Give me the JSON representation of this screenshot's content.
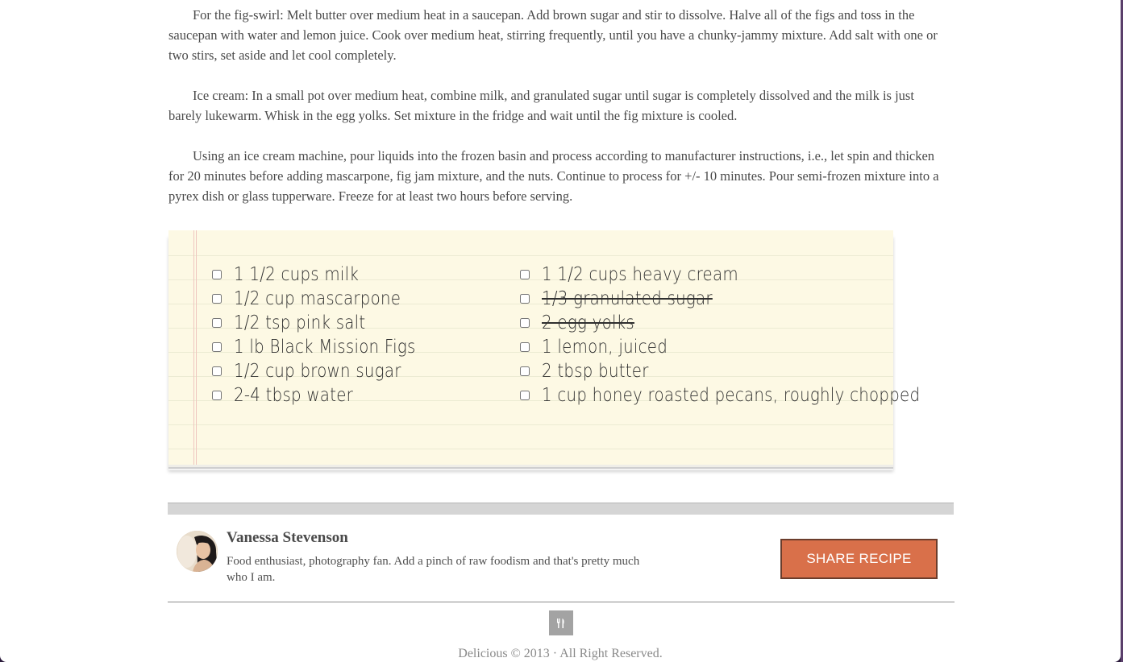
{
  "directions": [
    "For the fig-swirl: Melt butter over medium heat in a saucepan. Add brown sugar and stir to dissolve. Halve all of the figs and toss in the saucepan with water and lemon juice. Cook over medium heat, stirring frequently, until you have a chunky-jammy mixture. Add salt with one or two stirs, set aside and let cool completely.",
    "Ice cream: In a small pot over medium heat, combine milk, and granulated sugar until sugar is completely dissolved and the milk is just barely lukewarm. Whisk in the egg yolks. Set mixture in the fridge and wait until the fig mixture is cooled.",
    "Using an ice cream machine, pour liquids into the frozen basin and process according to manufacturer instructions, i.e., let spin and thicken for 20 minutes before adding mascarpone, fig jam mixture, and the nuts. Continue to process for +/- 10 minutes. Pour semi-frozen mixture into a pyrex dish or glass tupperware. Freeze for at least two hours before serving."
  ],
  "ingredients": {
    "left": [
      {
        "text": "1 1/2 cups milk",
        "checked": false,
        "struck": false
      },
      {
        "text": "1/2 cup mascarpone",
        "checked": false,
        "struck": false
      },
      {
        "text": "1/2 tsp pink salt",
        "checked": false,
        "struck": false
      },
      {
        "text": "1 lb Black Mission Figs",
        "checked": false,
        "struck": false
      },
      {
        "text": "1/2 cup brown sugar",
        "checked": false,
        "struck": false
      },
      {
        "text": "2-4 tbsp water",
        "checked": false,
        "struck": false
      }
    ],
    "right": [
      {
        "text": "1 1/2 cups heavy cream",
        "checked": false,
        "struck": false
      },
      {
        "text": "1/3 granulated sugar",
        "checked": false,
        "struck": true
      },
      {
        "text": "2 egg yolks",
        "checked": false,
        "struck": true
      },
      {
        "text": "1 lemon, juiced",
        "checked": false,
        "struck": false
      },
      {
        "text": "2 tbsp butter",
        "checked": false,
        "struck": false
      },
      {
        "text": "1 cup honey roasted pecans, roughly chopped",
        "checked": false,
        "struck": false
      }
    ]
  },
  "author": {
    "name": "Vanessa Stevenson",
    "bio": "Food enthusiast, photography fan. Add a pinch of raw foodism and that's pretty much who I am."
  },
  "share_button": {
    "label": "SHARE RECIPE"
  },
  "footer": {
    "logo_icon": "fork-knife-icon",
    "text": "Delicious © 2013 · All Right Reserved."
  },
  "colors": {
    "accent": "#d9704a",
    "notepad": "#fdf9e4",
    "frame": "#5a3f6b"
  }
}
